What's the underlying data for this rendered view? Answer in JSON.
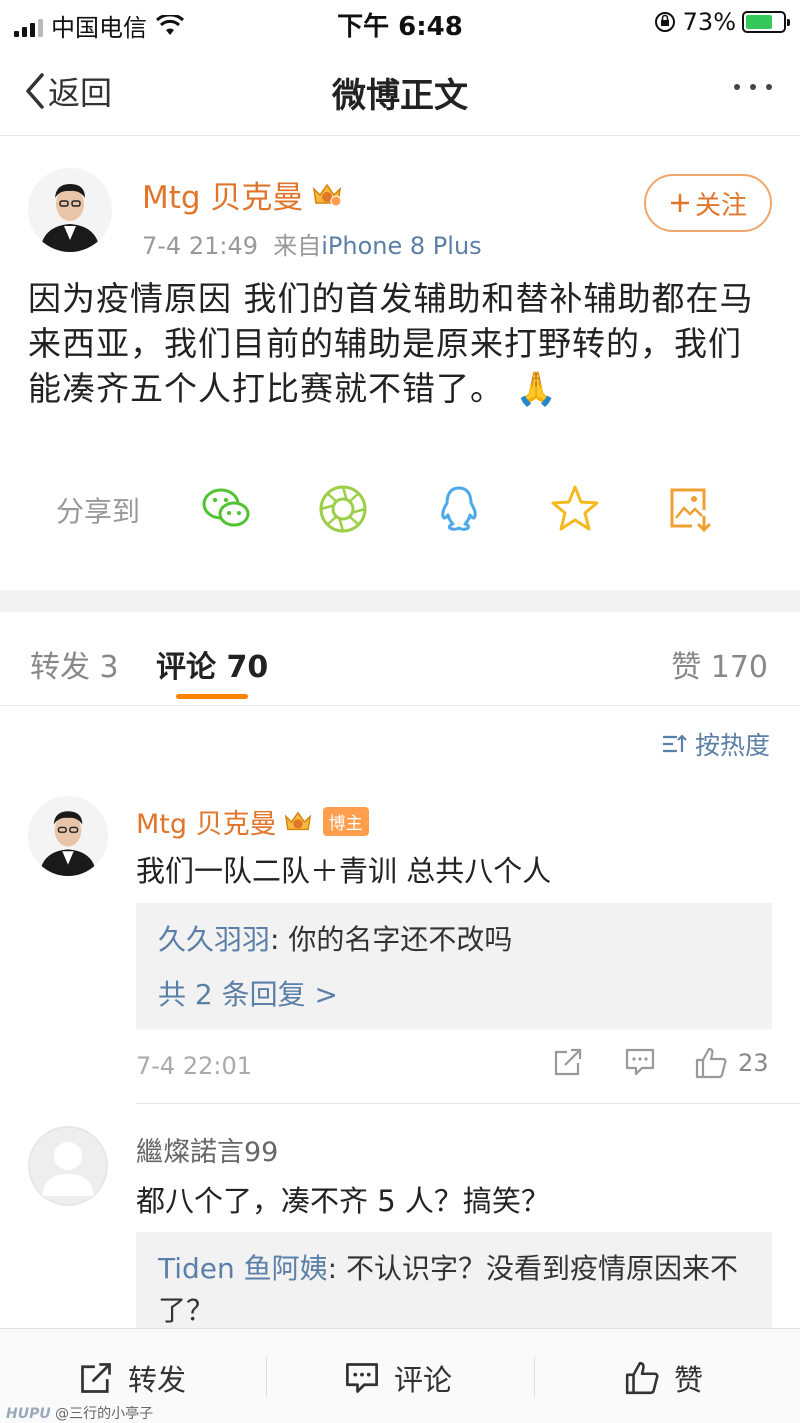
{
  "status_bar": {
    "carrier": "中国电信",
    "time": "下午 6:48",
    "battery": "73%",
    "battery_level": 0.73
  },
  "nav": {
    "back_label": "返回",
    "title": "微博正文"
  },
  "post": {
    "author": "Mtg 贝克曼",
    "time": "7-4 21:49",
    "source_prefix": "来自",
    "source": "iPhone 8 Plus",
    "follow_label": "关注",
    "text": "因为疫情原因 我们的首发辅助和替补辅助都在马来西亚，我们目前的辅助是原来打野转的，我们能凑齐五个人打比赛就不错了。",
    "emoji": "🙏",
    "share_label": "分享到",
    "share_icons": [
      "wechat-icon",
      "moments-icon",
      "qq-icon",
      "favorite-star-icon",
      "save-image-icon"
    ]
  },
  "tabs": {
    "repost": "转发 3",
    "comment": "评论 70",
    "like": "赞 170"
  },
  "sort_label": "按热度",
  "comments": [
    {
      "author": "Mtg 贝克曼",
      "badge": "博主",
      "text": "我们一队二队＋青训 总共八个人",
      "reply_user": "久久羽羽",
      "reply_text": ": 你的名字还不改吗",
      "reply_more": "共 2 条回复 >",
      "time": "7-4 22:01",
      "likes": "23"
    },
    {
      "author": "繼燦諾言99",
      "text": "都八个了，凑不齐 5 人？搞笑？",
      "reply_user": "Tiden 鱼阿姨",
      "reply_text": ": 不认识字？没看到疫情原因来不了？"
    }
  ],
  "bottom_bar": {
    "repost": "转发",
    "comment": "评论",
    "like": "赞"
  },
  "watermark": {
    "brand": "HUPU",
    "text": "@三行的小亭子"
  },
  "colors": {
    "accent_orange": "#e0752b",
    "link_blue": "#5b7fa6",
    "tab_underline": "#ff8200"
  }
}
